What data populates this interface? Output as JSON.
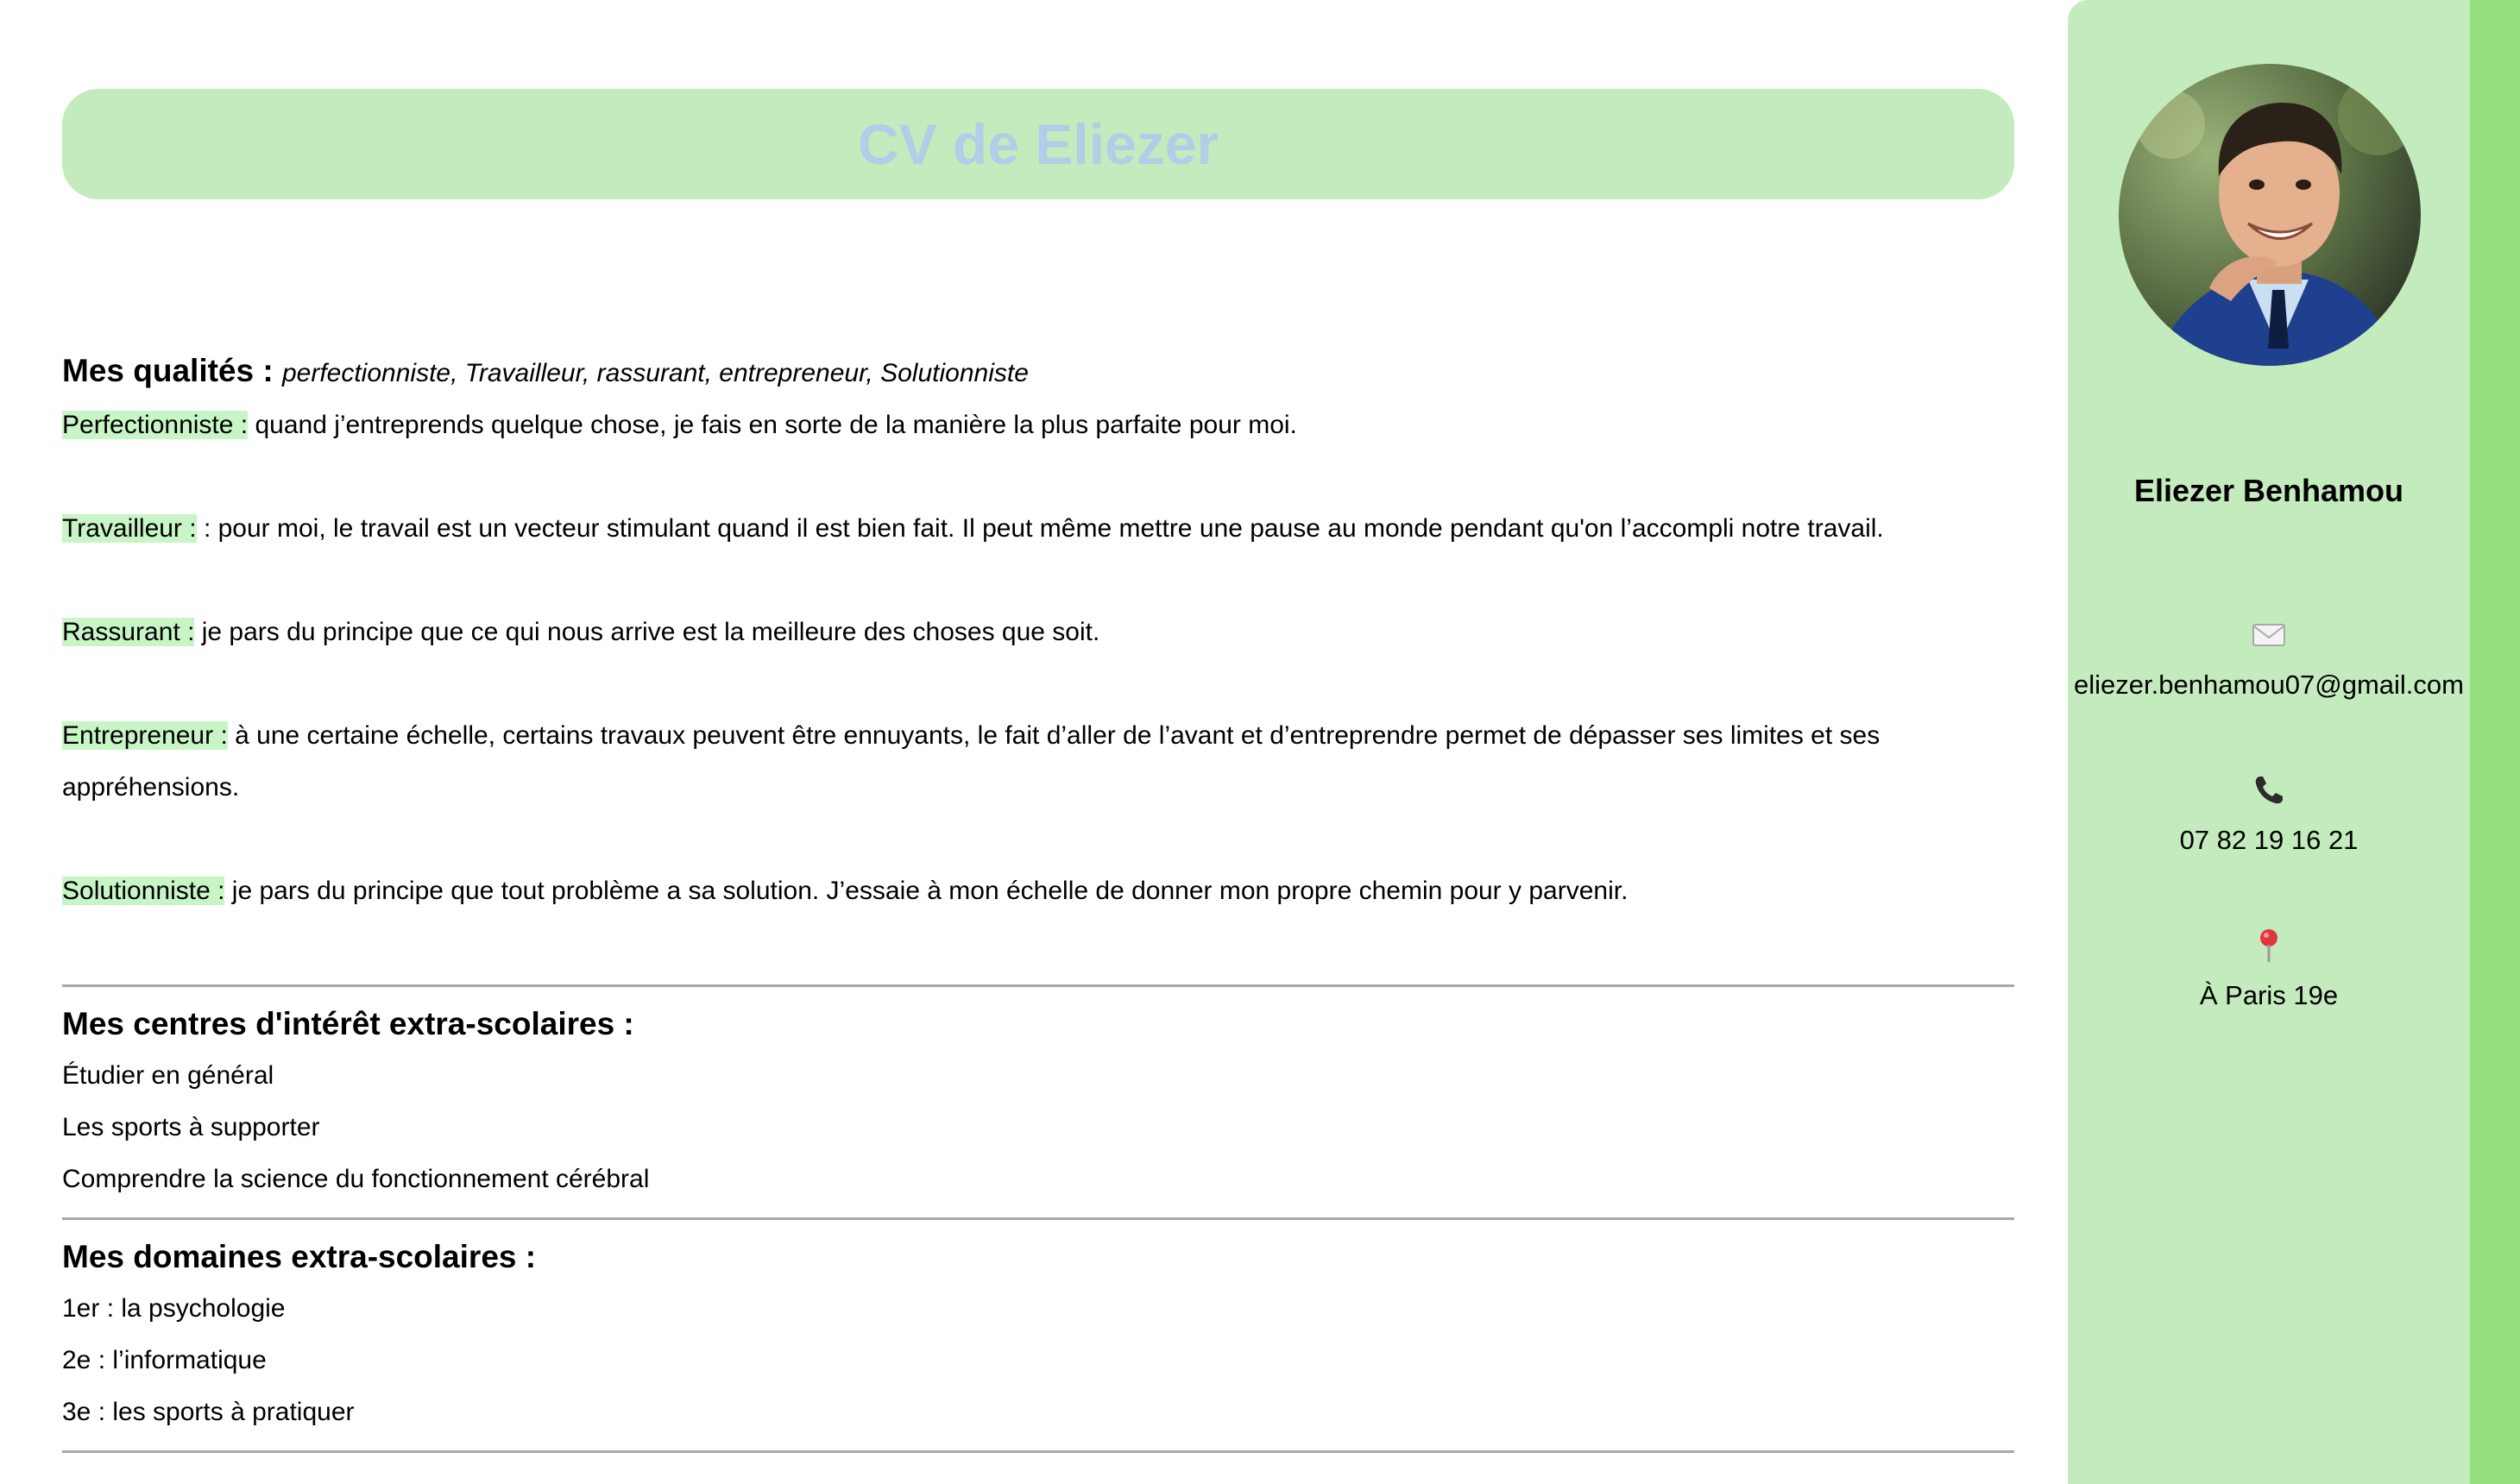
{
  "header": {
    "title": "CV de Eliezer"
  },
  "qualities": {
    "heading": "Mes qualités :",
    "list": "perfectionniste, Travailleur, rassurant, entrepreneur, Solutionniste",
    "items": [
      {
        "label": "Perfectionniste :",
        "text": "quand j’entreprends quelque chose, je fais en sorte de la manière la plus parfaite pour moi."
      },
      {
        "label": "Travailleur :",
        "text": ": pour moi, le travail est un vecteur stimulant quand il est bien fait. Il peut même mettre une pause au monde pendant qu'on l’accompli notre travail."
      },
      {
        "label": "Rassurant :",
        "text": "je pars du principe que ce qui nous arrive est la meilleure des choses que soit."
      },
      {
        "label": "Entrepreneur :",
        "text": "à une certaine échelle, certains travaux peuvent être ennuyants, le fait d’aller de l’avant et d’entreprendre permet de dépasser ses limites et ses appréhensions."
      },
      {
        "label": "Solutionniste :",
        "text": "je pars du principe que tout problème a sa solution. J’essaie à mon échelle de donner mon propre chemin pour y parvenir."
      }
    ]
  },
  "interests": {
    "heading": "Mes centres d'intérêt extra-scolaires :",
    "items": [
      "Étudier en général",
      "Les sports à supporter",
      "Comprendre la science du fonctionnement cérébral"
    ]
  },
  "domains": {
    "heading": "Mes domaines extra-scolaires :",
    "items": [
      "1er : la psychologie",
      "2e : l’informatique",
      "3e : les sports à pratiquer"
    ]
  },
  "sidebar": {
    "name": "Eliezer Benhamou",
    "email": "eliezer.benhamou07@gmail.com",
    "phone": "07 82 19 16 21",
    "location": "À Paris 19e",
    "icons": {
      "email": "envelope-icon",
      "phone": "telephone-icon",
      "location": "pin-icon"
    }
  },
  "colors": {
    "title_bar_bg": "#c4ebbd",
    "title_text": "#b3cde8",
    "highlight": "#c8f5c6",
    "sidebar_bg": "#c4ebbd",
    "side_strip": "#94e07e"
  }
}
